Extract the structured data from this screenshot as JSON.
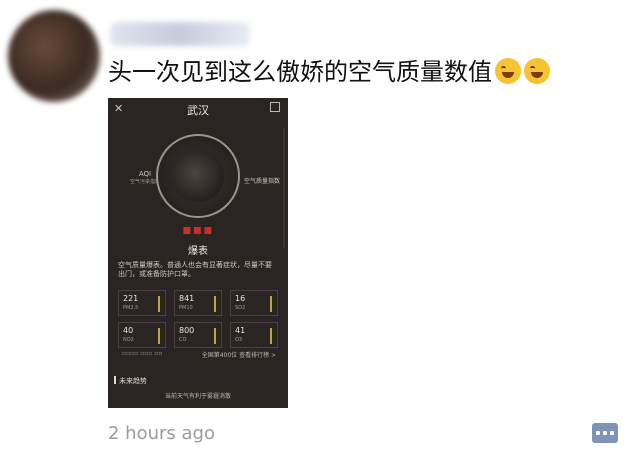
{
  "post": {
    "caption": "头一次见到这么傲娇的空气质量数值",
    "emojis": [
      "rofl-emoji",
      "rofl-emoji"
    ],
    "timestamp": "2 hours ago"
  },
  "screenshot": {
    "title": "武汉",
    "aqi_label": "AQI",
    "aqi_sub": "空气污染指数",
    "right_label": "空气质量指数",
    "level": "爆表",
    "description": "空气质量爆表。普通人也会有显著症状，尽量不要出门，或准备防护口罩。",
    "metrics": [
      {
        "value": "221",
        "name": "PM2.5"
      },
      {
        "value": "841",
        "name": "PM10"
      },
      {
        "value": "16",
        "name": "SO2"
      },
      {
        "value": "40",
        "name": "NO2"
      },
      {
        "value": "800",
        "name": "CO"
      },
      {
        "value": "41",
        "name": "O3"
      }
    ],
    "footer_right": "全国第400位 查看排行榜 >",
    "trend_label": "未来趋势",
    "advice": "当前天气有利于雾霾消散"
  },
  "colors": {
    "screen_bg": "#2a2422",
    "alert_red": "#c9302c",
    "metric_bar": "#c8a23a",
    "comment_button": "#7f93b6"
  }
}
